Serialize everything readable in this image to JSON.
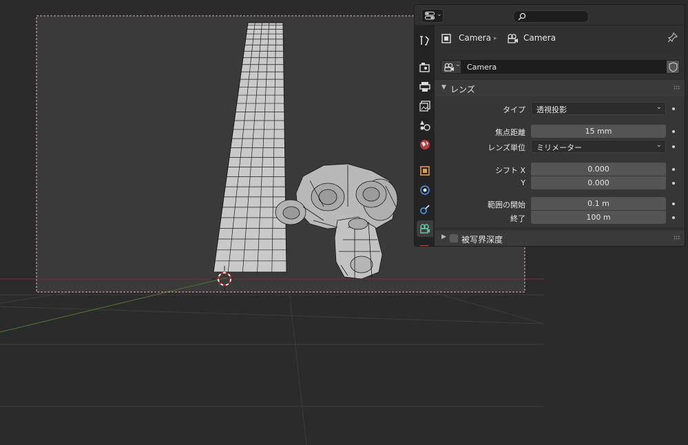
{
  "viewport": {
    "colors": {
      "background": "#303030",
      "passepartout": "#3a3a3a",
      "camera_border": "#e8a0a0",
      "grid": "#444444",
      "x_axis": "#7a3c3c",
      "y_axis": "#5b7a3a",
      "mesh": "#c8c8c8",
      "wire": "#1a1a1a"
    },
    "objects": [
      "plane-mesh",
      "suzanne-mesh",
      "3d-cursor"
    ]
  },
  "properties": {
    "header": {
      "editor_icon": "properties-editor-icon",
      "search_placeholder": ""
    },
    "tabs": [
      {
        "name": "tool",
        "active": false
      },
      {
        "name": "render",
        "active": false
      },
      {
        "name": "output",
        "active": false
      },
      {
        "name": "view-layer",
        "active": false
      },
      {
        "name": "scene",
        "active": false
      },
      {
        "name": "world",
        "active": false
      },
      {
        "name": "object",
        "active": false
      },
      {
        "name": "physics",
        "active": false
      },
      {
        "name": "constraints",
        "active": false
      },
      {
        "name": "object-data-camera",
        "active": true
      }
    ],
    "breadcrumb": {
      "object": "Camera",
      "data": "Camera"
    },
    "datablock": {
      "name": "Camera"
    },
    "lens_panel": {
      "title": "レンズ",
      "type_label": "タイプ",
      "type_value": "透視投影",
      "focal_label": "焦点距離",
      "focal_value": "15 mm",
      "unit_label": "レンズ単位",
      "unit_value": "ミリメーター",
      "shift_x_label": "シフト X",
      "shift_x_value": "0.000",
      "shift_y_label": "Y",
      "shift_y_value": "0.000",
      "clip_start_label": "範囲の開始",
      "clip_start_value": "0.1 m",
      "clip_end_label": "終了",
      "clip_end_value": "100 m"
    },
    "dof_panel": {
      "title": "被写界深度",
      "enabled": false
    }
  }
}
